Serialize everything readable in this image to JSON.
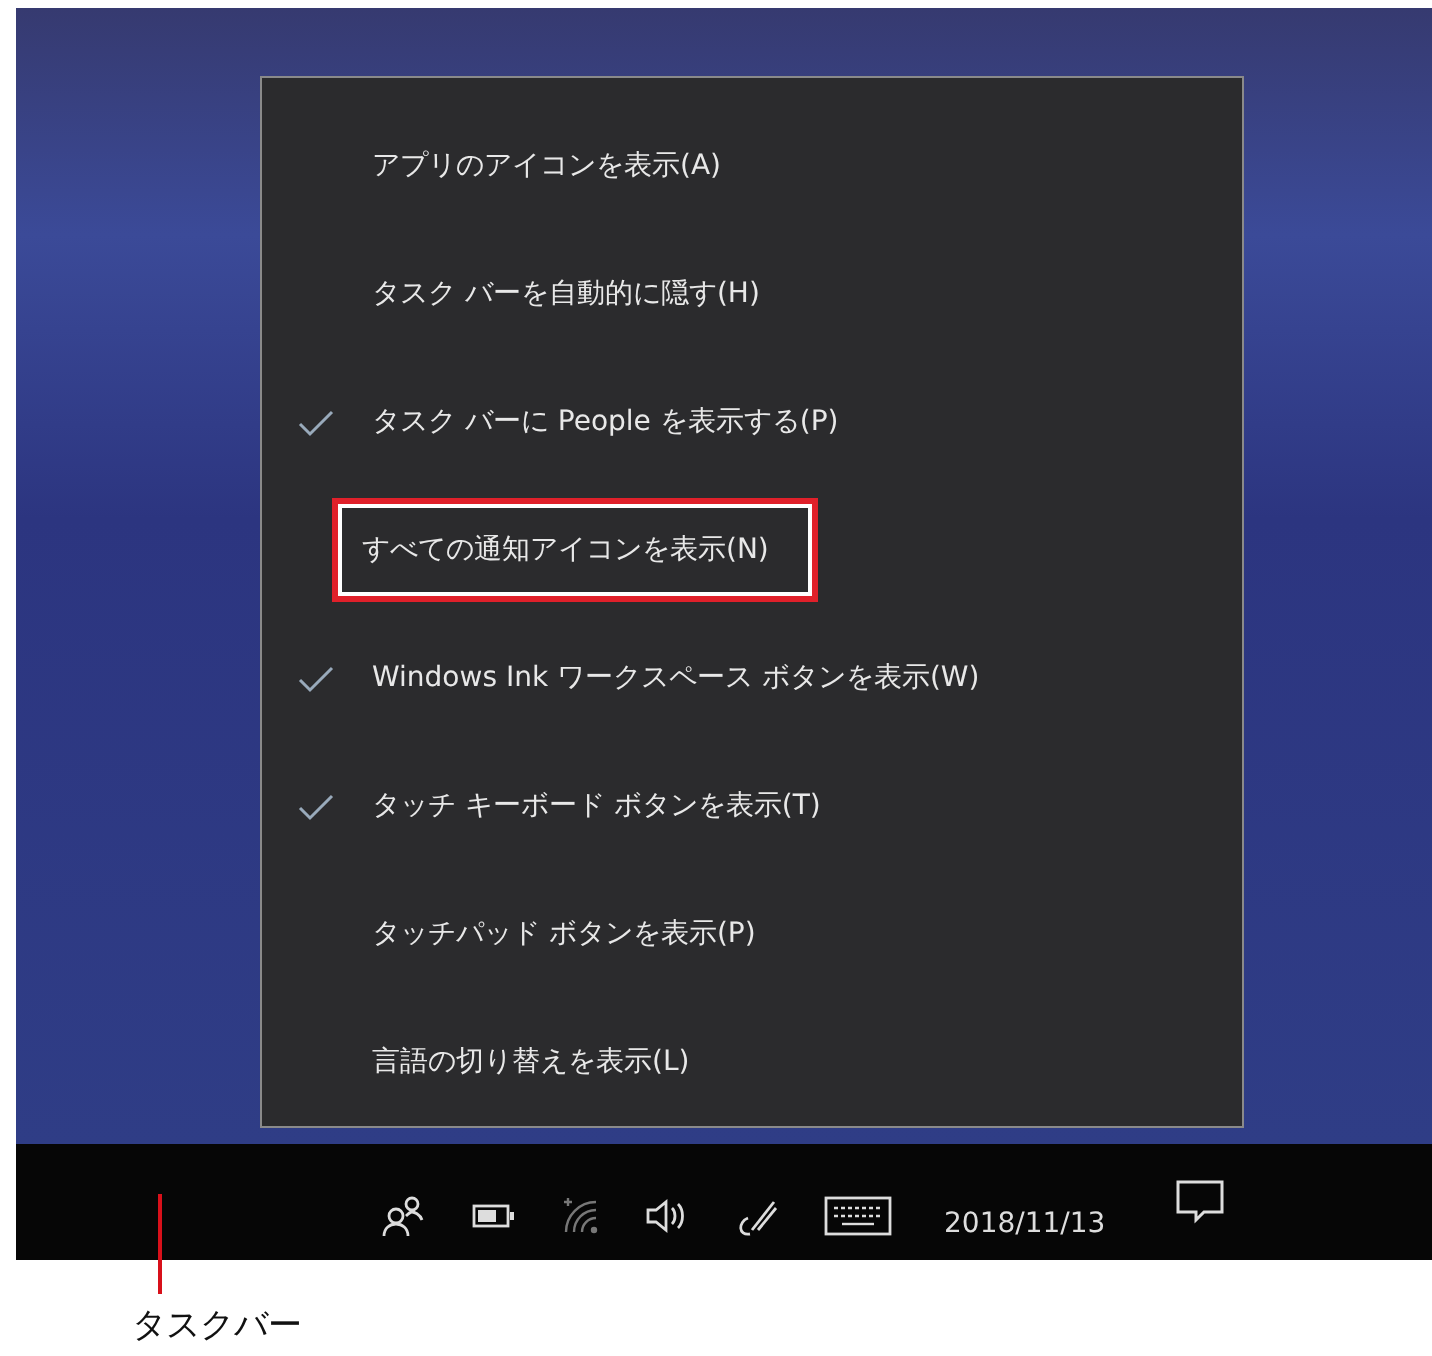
{
  "context_menu": {
    "items": [
      {
        "label": "アプリのアイコンを表示(A)",
        "checked": false,
        "highlighted": false
      },
      {
        "label": "タスク バーを自動的に隠す(H)",
        "checked": false,
        "highlighted": false
      },
      {
        "label": "タスク バーに People を表示する(P)",
        "checked": true,
        "highlighted": false
      },
      {
        "label": "すべての通知アイコンを表示(N)",
        "checked": false,
        "highlighted": true
      },
      {
        "label": "Windows Ink ワークスペース ボタンを表示(W)",
        "checked": true,
        "highlighted": false
      },
      {
        "label": "タッチ キーボード ボタンを表示(T)",
        "checked": true,
        "highlighted": false
      },
      {
        "label": "タッチパッド ボタンを表示(P)",
        "checked": false,
        "highlighted": false
      },
      {
        "label": "言語の切り替えを表示(L)",
        "checked": false,
        "highlighted": false
      }
    ]
  },
  "taskbar": {
    "date": "2018/11/13"
  },
  "callout": {
    "label": "タスクバー"
  }
}
